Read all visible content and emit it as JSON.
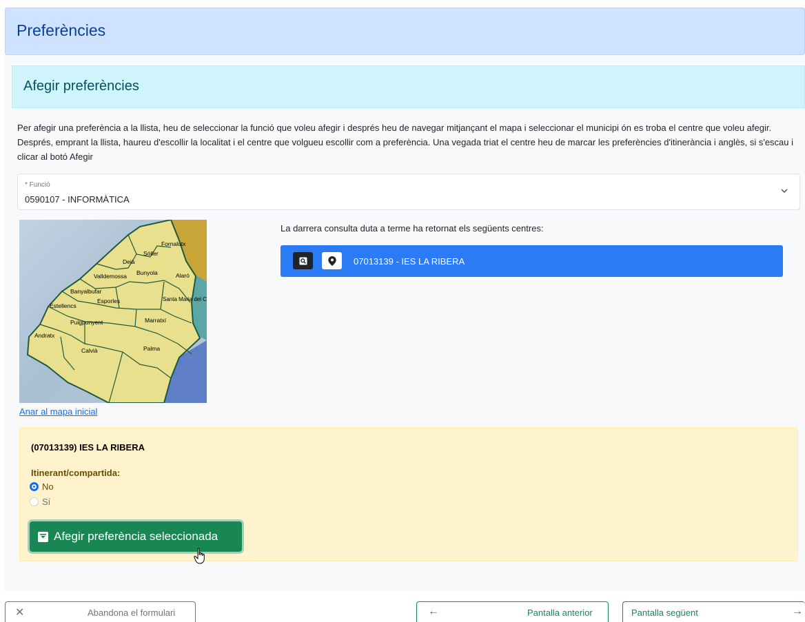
{
  "header": {
    "title": "Preferències"
  },
  "section": {
    "title": "Afegir preferències"
  },
  "intro_text": "Per afegir una preferència a la llista, heu de seleccionar la funció que voleu afegir i després heu de navegar mitjançant el mapa i seleccionar el municipi ón es troba el centre que voleu afegir. Després, emprant la llista, haureu d'escollir la localitat i el centre que volgueu escollir com a preferència. Una vegada triat el centre heu de marcar les preferències d'itinerància i anglès, si s'escau i clicar al botó Afegir",
  "funcio": {
    "label": "* Funció",
    "value": "0590107 - INFORMÀTICA",
    "icon": "chevron-down-icon"
  },
  "map": {
    "link": "Anar al mapa inicial",
    "municipalities": [
      "Fornalutx",
      "Sóller",
      "Deià",
      "Valldemossa",
      "Bunyola",
      "Alaró",
      "Banyalbufar",
      "Esporles",
      "Santa Maria del Camí",
      "Estellencs",
      "Puigpunyent",
      "Marratxí",
      "Andratx",
      "Calvià",
      "Palma"
    ],
    "colors": {
      "land": "#e8e08c",
      "sea": "#a9c3d8",
      "outline": "#1f5a3c"
    }
  },
  "results": {
    "title": "La darrera consulta duta a terme ha retornat els següents centres:",
    "items": [
      {
        "label": "07013139 - IES LA RIBERA",
        "icons": [
          "search-icon",
          "map-marker-icon"
        ]
      }
    ]
  },
  "selected": {
    "title": "(07013139)  IES LA RIBERA",
    "itinerant_label": "Itinerant/compartida:",
    "options": [
      {
        "label": "No",
        "checked": true
      },
      {
        "label": "Sí",
        "checked": false
      }
    ],
    "add_button": "Afegir preferència seleccionada"
  },
  "footer": {
    "abandon": "Abandona el formulari",
    "previous": "Pantalla anterior",
    "next": "Pantalla següent"
  },
  "colors": {
    "primary": "#2b7bf5",
    "success": "#198754",
    "info_bg": "#cff4fc",
    "warning_bg": "#fff3cd",
    "header_bg": "#cfe2ff"
  }
}
